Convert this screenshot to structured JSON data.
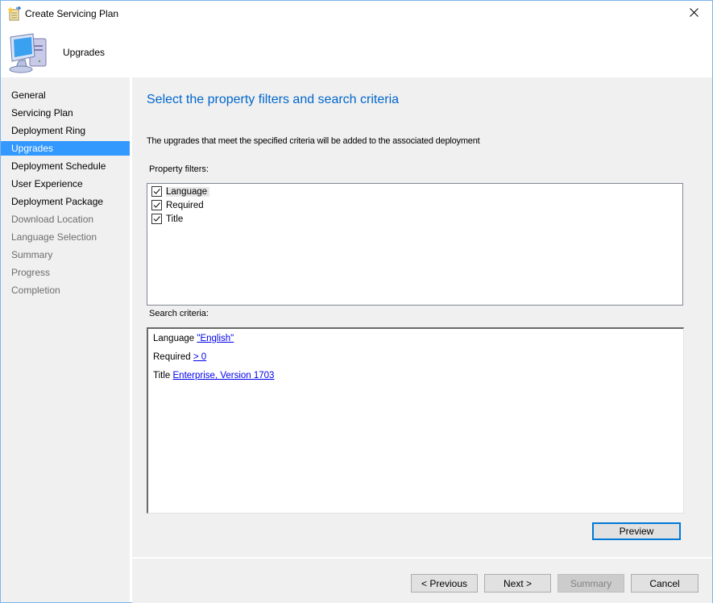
{
  "window": {
    "title": "Create Servicing Plan",
    "close_icon": "close-icon"
  },
  "header": {
    "title": "Upgrades",
    "icon": "computer-icon"
  },
  "sidebar": {
    "items": [
      {
        "label": "General",
        "state": "normal"
      },
      {
        "label": "Servicing Plan",
        "state": "normal"
      },
      {
        "label": "Deployment Ring",
        "state": "normal"
      },
      {
        "label": "Upgrades",
        "state": "active"
      },
      {
        "label": "Deployment Schedule",
        "state": "normal"
      },
      {
        "label": "User Experience",
        "state": "normal"
      },
      {
        "label": "Deployment Package",
        "state": "normal"
      },
      {
        "label": "Download Location",
        "state": "disabled"
      },
      {
        "label": "Language Selection",
        "state": "disabled"
      },
      {
        "label": "Summary",
        "state": "disabled"
      },
      {
        "label": "Progress",
        "state": "disabled"
      },
      {
        "label": "Completion",
        "state": "disabled"
      }
    ]
  },
  "main": {
    "title": "Select the property filters and search criteria",
    "description": "The upgrades that meet the specified criteria will be added to the associated deployment",
    "property_filters_label": "Property filters:",
    "property_filters": [
      {
        "label": "Language",
        "checked": true
      },
      {
        "label": "Required",
        "checked": true
      },
      {
        "label": "Title",
        "checked": true
      }
    ],
    "search_criteria_label": "Search criteria:",
    "search_criteria": [
      {
        "property": "Language",
        "value": "\"English\""
      },
      {
        "property": "Required",
        "value": "> 0"
      },
      {
        "property": "Title",
        "value": "Enterprise, Version 1703"
      }
    ],
    "preview_label": "Preview"
  },
  "footer": {
    "previous_label": "< Previous",
    "next_label": "Next >",
    "summary_label": "Summary",
    "cancel_label": "Cancel"
  }
}
